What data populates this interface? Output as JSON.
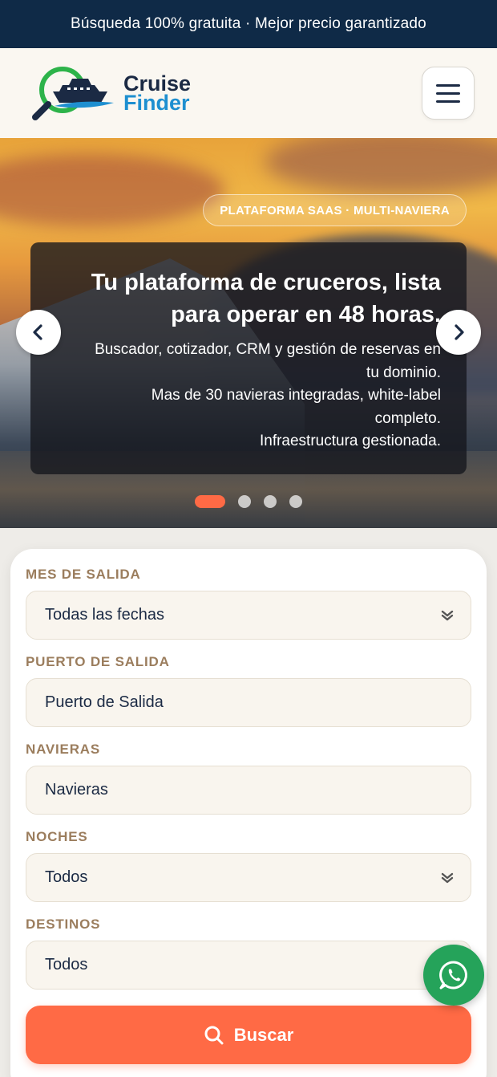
{
  "topbar": {
    "text": "Búsqueda 100% gratuita · Mejor precio garantizado"
  },
  "header": {
    "logo_line1": "Cruise",
    "logo_line2": "Finder",
    "menu_icon": "hamburger-menu-icon"
  },
  "hero": {
    "badge": "PLATAFORMA SAAS · MULTI-NAVIERA",
    "title_line1": "Tu plataforma de cruceros, lista",
    "title_line2": "para operar en 48 horas.",
    "desc_line1": "Buscador, cotizador, CRM y gestión de reservas en",
    "desc_line2": "tu dominio.",
    "desc_line3": "Mas de 30 navieras integradas, white-label",
    "desc_line4": "completo.",
    "desc_line5": "Infraestructura gestionada.",
    "active_slide": 1,
    "total_slides": 4
  },
  "search_form": {
    "fields": [
      {
        "label": "MES DE SALIDA",
        "value": "Todas las fechas",
        "has_dropdown": true
      },
      {
        "label": "PUERTO DE SALIDA",
        "value": "Puerto de Salida",
        "has_dropdown": false
      },
      {
        "label": "NAVIERAS",
        "value": "Navieras",
        "has_dropdown": false
      },
      {
        "label": "NOCHES",
        "value": "Todos",
        "has_dropdown": true
      },
      {
        "label": "DESTINOS",
        "value": "Todos",
        "has_dropdown": false
      }
    ],
    "submit_label": "Buscar"
  },
  "colors": {
    "navy": "#0f2a47",
    "accent": "#ff6a45",
    "label_brown": "#9b7d5d",
    "whatsapp_green": "#25a35a"
  }
}
